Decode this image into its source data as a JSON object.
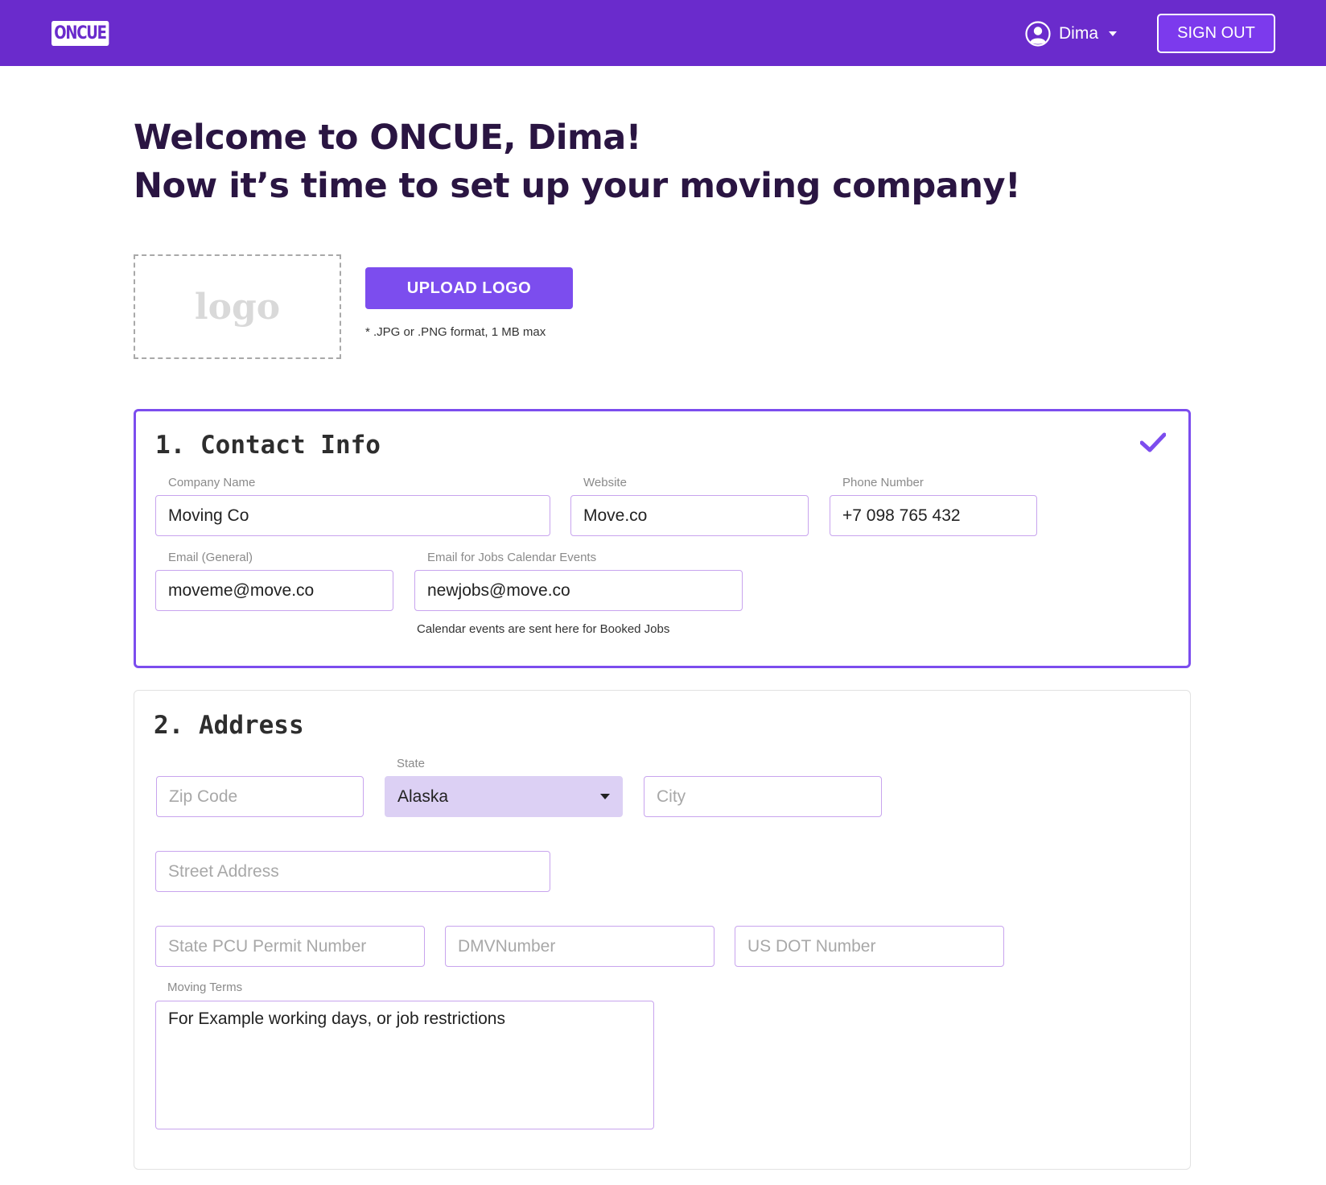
{
  "header": {
    "brand": "ONCUE",
    "user_name": "Dima",
    "sign_out_label": "SIGN OUT",
    "brand_color": "#6a2bcc"
  },
  "welcome": {
    "line1": "Welcome to ONCUE, Dima!",
    "line2": "Now it’s time to set up your moving company!"
  },
  "logo_upload": {
    "placeholder": "logo",
    "button_label": "UPLOAD LOGO",
    "hint": "* .JPG or .PNG format, 1 MB max"
  },
  "contact": {
    "title": "1. Contact Info",
    "completed": true,
    "company_name": {
      "label": "Company Name",
      "value": "Moving Co"
    },
    "website": {
      "label": "Website",
      "value": "Move.co"
    },
    "phone": {
      "label": "Phone Number",
      "value": "+7 098 765 432"
    },
    "email_general": {
      "label": "Email (General)",
      "value": "moveme@move.co"
    },
    "email_calendar": {
      "label": "Email for Jobs Calendar Events",
      "value": "newjobs@move.co",
      "helper": "Calendar events are sent here for Booked Jobs"
    }
  },
  "address": {
    "title": "2. Address",
    "zip": {
      "placeholder": "Zip Code"
    },
    "state": {
      "label": "State",
      "value": "Alaska"
    },
    "city": {
      "placeholder": "City"
    },
    "street": {
      "placeholder": "Street Address"
    },
    "pcu": {
      "placeholder": "State PCU Permit Number"
    },
    "dmv": {
      "placeholder": "DMVNumber"
    },
    "dot": {
      "placeholder": "US DOT Number"
    },
    "terms": {
      "label": "Moving Terms",
      "placeholder": "For Example working days, or job restrictions"
    }
  }
}
